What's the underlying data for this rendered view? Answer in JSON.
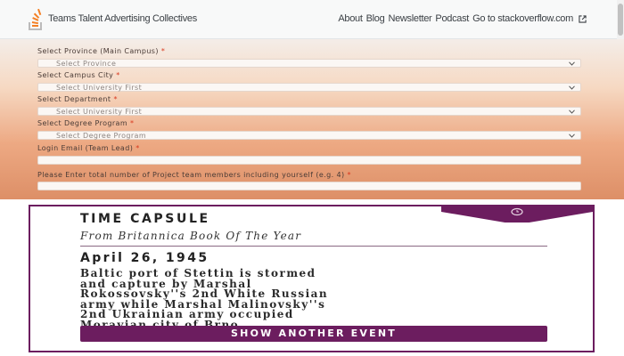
{
  "nav": {
    "brand": "Teams Talent Advertising Collectives",
    "links": [
      "About",
      "Blog",
      "Newsletter",
      "Podcast",
      "Go to stackoverflow.com"
    ],
    "external_icon": "external-link-icon",
    "logo_icon": "stackoverflow-logo-icon"
  },
  "form": {
    "province_label": "Select Province (Main Campus)",
    "province_placeholder": "Select Province",
    "city_label": "Select Campus City",
    "city_placeholder": "Select University First",
    "department_label": "Select Department",
    "department_placeholder": "Select University First",
    "degree_label": "Select Degree Program",
    "degree_placeholder": "Select Degree Program",
    "email_label": "Login Email (Team Lead)",
    "members_label": "Please Enter total number of Project team members including yourself (e.g. 4)",
    "required_mark": "*"
  },
  "capsule": {
    "title": "TIME CAPSULE",
    "subtitle": "From Britannica Book Of The Year",
    "date": "April 26, 1945",
    "body_lines": [
      "Baltic port of Stettin is stormed",
      "and capture by Marshal",
      "Rokossovsky''s 2nd White Russian",
      "army while Marshal Malinovsky''s",
      "2nd Ukrainian army occupied",
      "Moravian city of Brno."
    ],
    "button_label": "SHOW ANOTHER EVENT",
    "corner_icon": "clock-icon"
  },
  "colors": {
    "accent": "#6c1d5f",
    "required": "#d9381e",
    "gradient_top": "#f4ede8",
    "gradient_bottom": "#dd8f67"
  }
}
